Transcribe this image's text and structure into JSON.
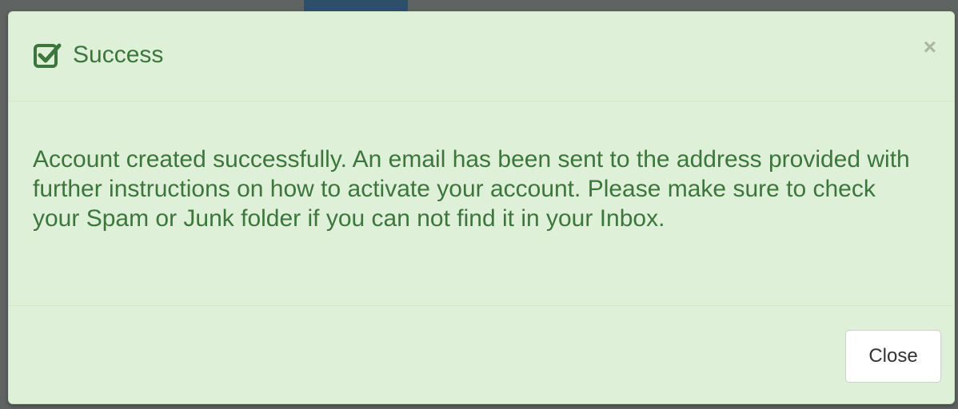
{
  "dialog": {
    "title": "Success",
    "close_symbol": "×",
    "message": "Account created successfully. An email has been sent to the address provided with further instructions on how to activate your account. Please make sure to check your Spam or Junk folder if you can not find it in your Inbox.",
    "close_button_label": "Close"
  },
  "icons": {
    "title_icon": "checkbox-checked-icon",
    "dismiss_icon": "close-icon"
  },
  "colors": {
    "alert_background": "#dff0d8",
    "alert_text": "#3c763d",
    "button_background": "#ffffff"
  }
}
